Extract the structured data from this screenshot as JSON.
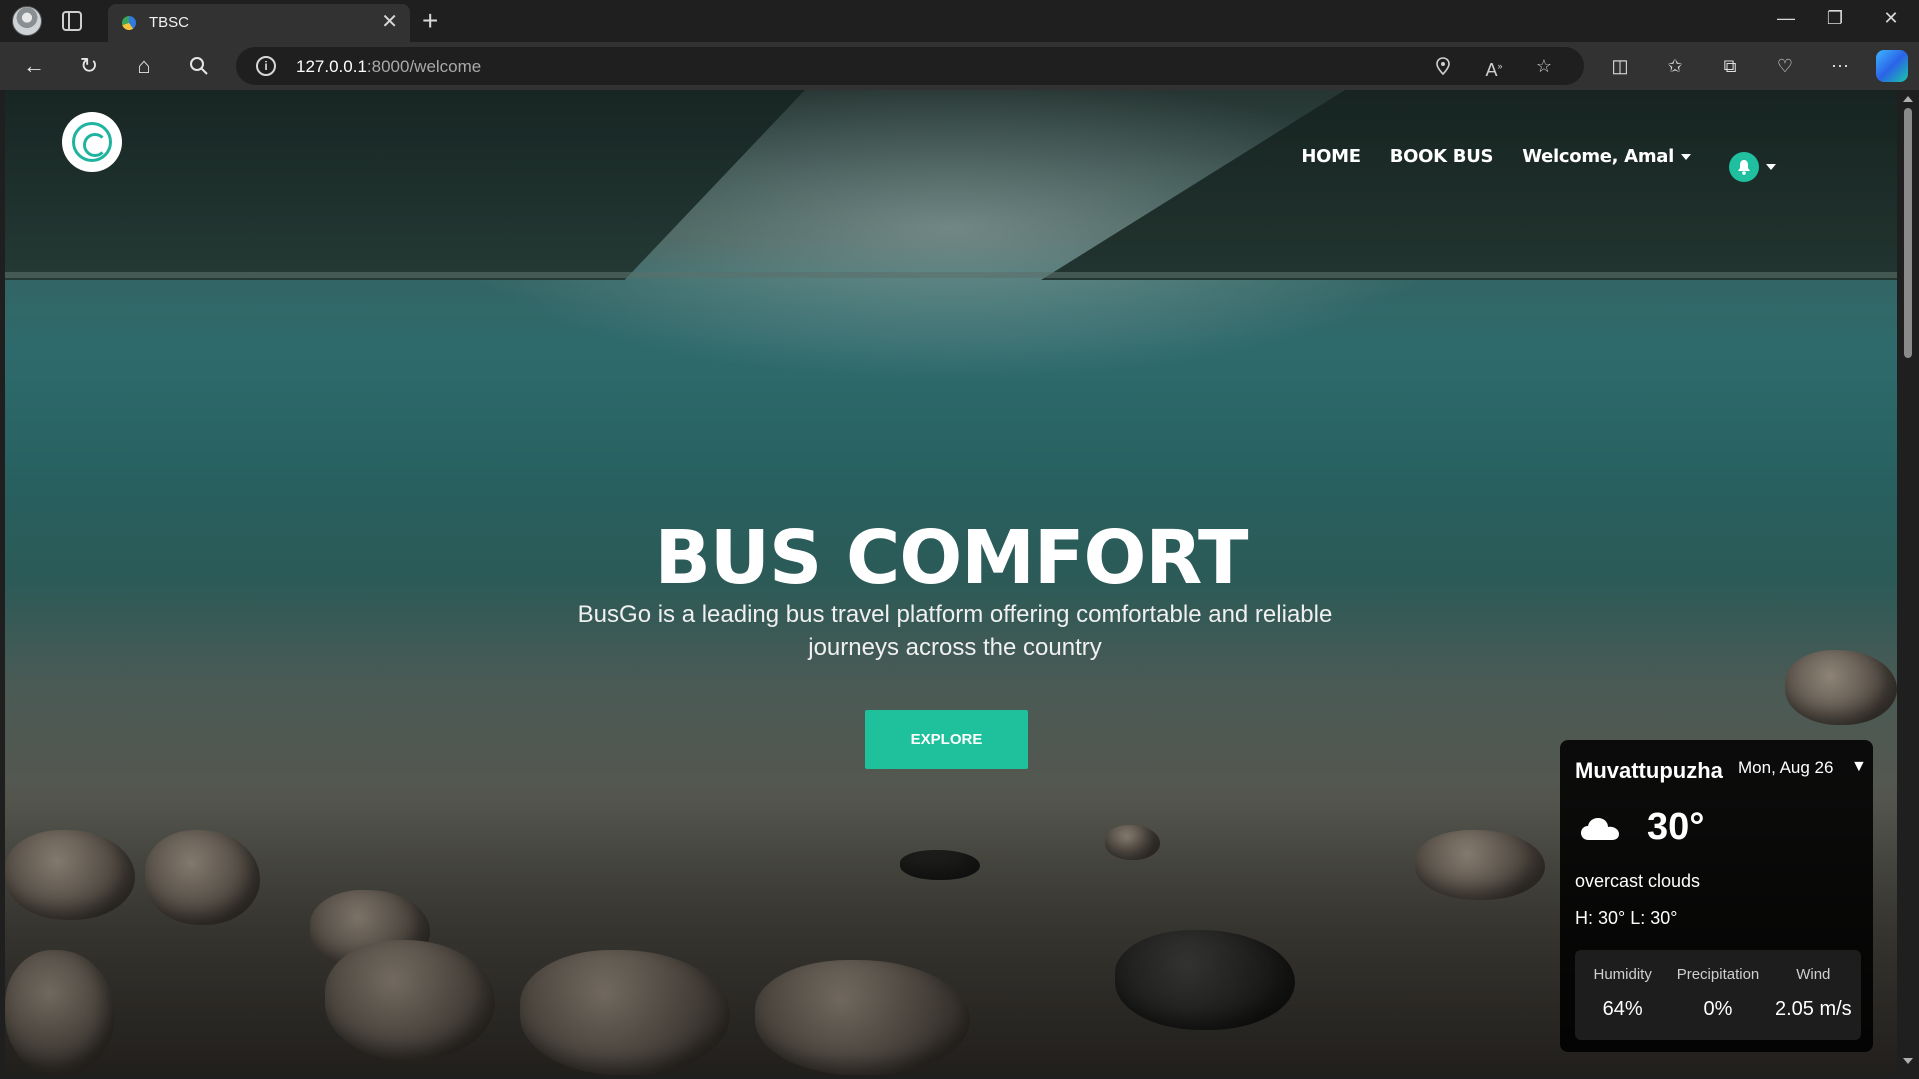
{
  "browser": {
    "tab_title": "TBSC",
    "tab_close": "✕",
    "new_tab": "+",
    "url_host": "127.0.0.1",
    "url_rest": ":8000/welcome",
    "window_controls": {
      "minimize": "—",
      "restore": "❐",
      "close": "✕"
    }
  },
  "navbar": {
    "home": "HOME",
    "book_bus": "BOOK BUS",
    "welcome": "Welcome, Amal"
  },
  "hero": {
    "title": "BUS COMFORT",
    "subtitle": "BusGo is a leading bus travel platform offering comfortable and reliable journeys across the country",
    "cta": "EXPLORE"
  },
  "weather": {
    "city": "Muvattupuzha",
    "date": "Mon, Aug 26",
    "caret": "▼",
    "icon": "cloud-icon",
    "temperature": "30°",
    "description": "overcast clouds",
    "high_low": "H: 30° L: 30°",
    "stats": [
      {
        "label": "Humidity",
        "value": "64%"
      },
      {
        "label": "Precipitation",
        "value": "0%"
      },
      {
        "label": "Wind",
        "value": "2.05 m/s"
      }
    ]
  },
  "colors": {
    "accent": "#1fc09c",
    "browser_bg": "#1f1f1f",
    "toolbar_bg": "#323232"
  }
}
